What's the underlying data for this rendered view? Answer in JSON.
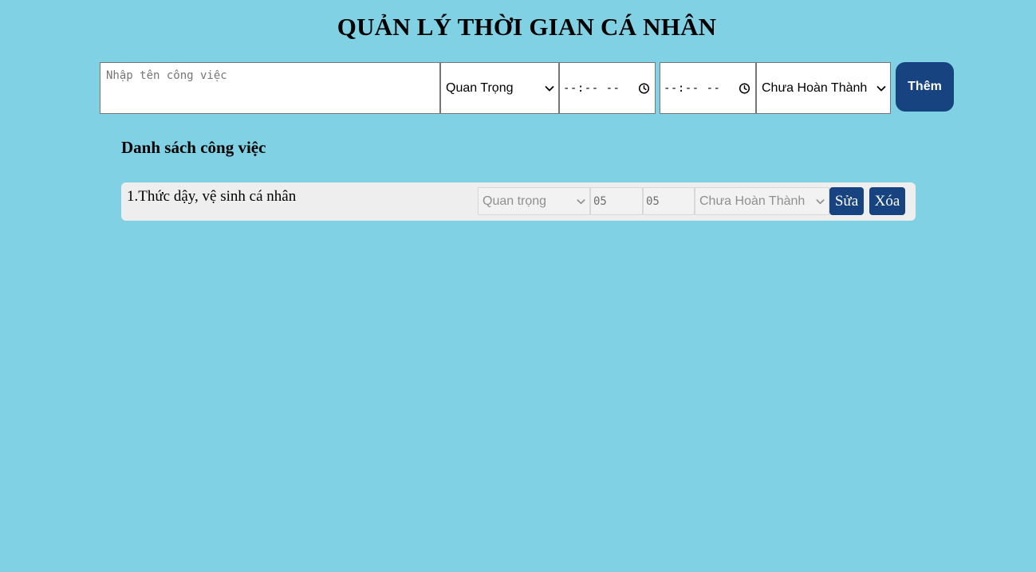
{
  "header": {
    "title": "QUẢN LÝ THỜI GIAN CÁ NHÂN"
  },
  "form": {
    "task_placeholder": "Nhập tên công việc",
    "priority_selected": "Quan Trọng",
    "start_time_display": "--:-- --",
    "end_time_display": "--:-- --",
    "status_selected": "Chưa Hoàn Thành",
    "add_label": "Thêm"
  },
  "list": {
    "heading": "Danh sách công việc",
    "items": [
      {
        "name": "1.Thức dậy, vệ sinh cá nhân",
        "priority": "Quan trọng",
        "start": "05",
        "end": "05",
        "status": "Chưa Hoàn Thành",
        "edit_label": "Sửa",
        "delete_label": "Xóa"
      }
    ]
  },
  "icons": {
    "dropdown": "chevron-down-icon",
    "time": "clock-icon"
  },
  "colors": {
    "background": "#81d1e4",
    "button": "#174380",
    "row_background": "#eeeeee"
  }
}
